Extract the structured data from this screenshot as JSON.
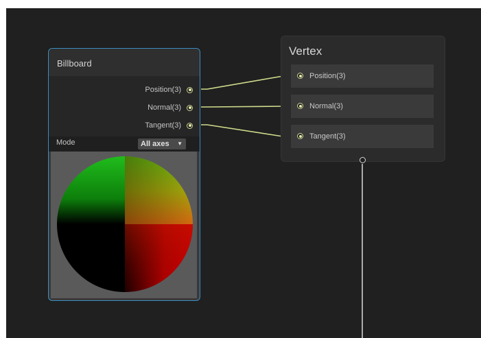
{
  "billboard_node": {
    "title": "Billboard",
    "outputs": [
      "Position(3)",
      "Normal(3)",
      "Tangent(3)"
    ],
    "mode_label": "Mode",
    "mode_value": "All axes"
  },
  "vertex_node": {
    "title": "Vertex",
    "inputs": [
      "Position(3)",
      "Normal(3)",
      "Tangent(3)"
    ]
  },
  "colors": {
    "canvas": "#202020",
    "node_border_selected": "#3f8fc4",
    "wire": "#d2dc8c",
    "port": "#e6eea8",
    "preview_background": "#5a5a5a"
  },
  "icons": {
    "port": "port-dot-icon",
    "dropdown": "dropdown-caret-icon"
  }
}
